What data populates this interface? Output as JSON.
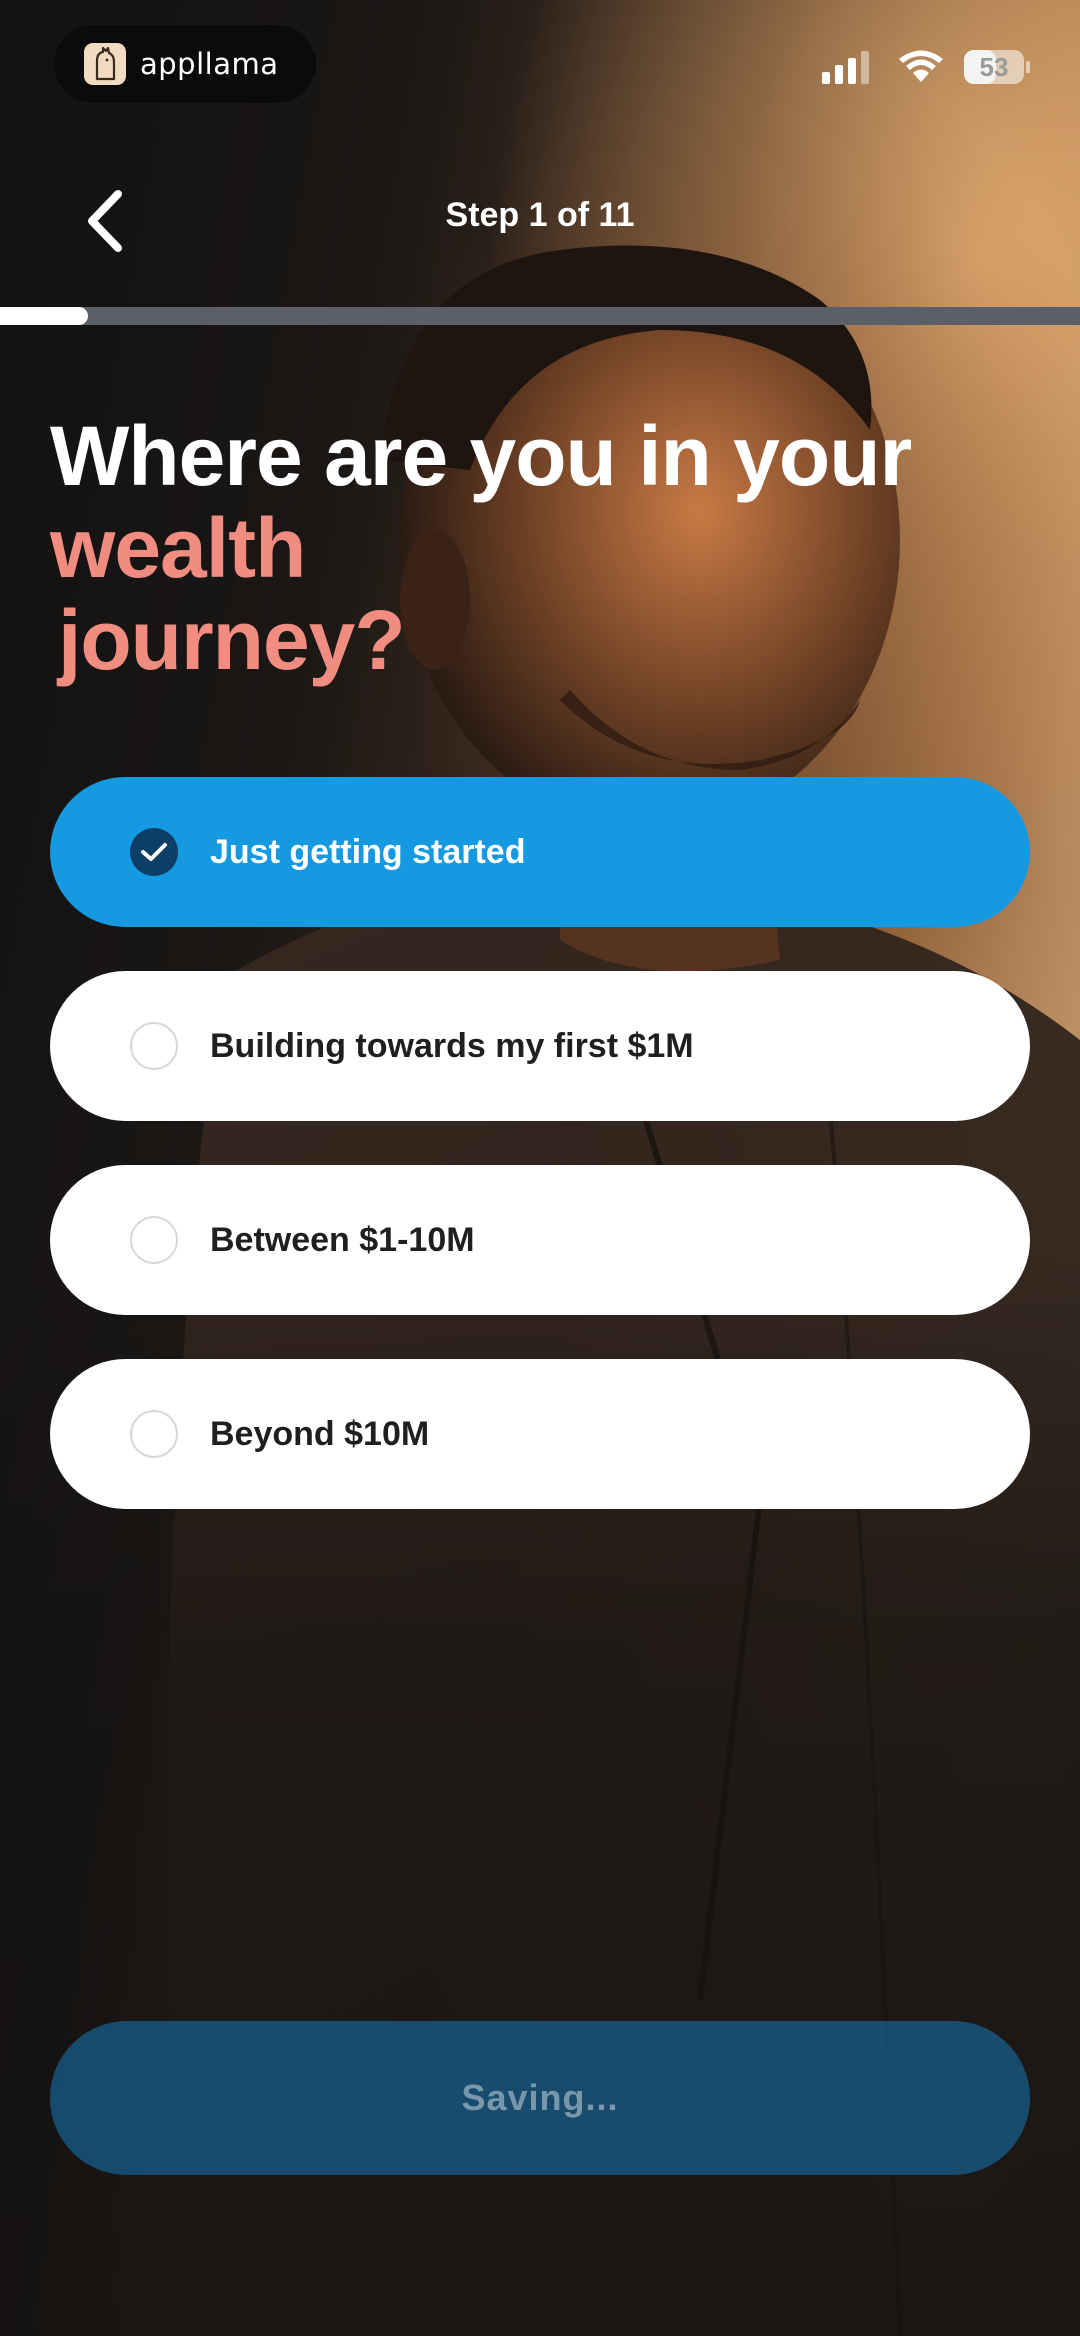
{
  "status_bar": {
    "app_name": "appllama",
    "app_icon": "llama-icon",
    "battery_percent": 53,
    "battery_label": "53"
  },
  "header": {
    "back_icon": "chevron-left-icon",
    "step_label": "Step 1 of 11",
    "progress": {
      "current": 1,
      "total": 11
    }
  },
  "title": {
    "line1": "Where are you in your",
    "line2": "wealth",
    "line3": "journey?"
  },
  "options": [
    {
      "label": "Just getting started",
      "selected": true
    },
    {
      "label": "Building towards my first $1M",
      "selected": false
    },
    {
      "label": "Between $1-10M",
      "selected": false
    },
    {
      "label": "Beyond $10M",
      "selected": false
    }
  ],
  "save_button": {
    "label": "Saving..."
  },
  "colors": {
    "accent_blue": "#1599e1",
    "title_accent": "#f08c80",
    "check_dark": "#0d3f66"
  }
}
